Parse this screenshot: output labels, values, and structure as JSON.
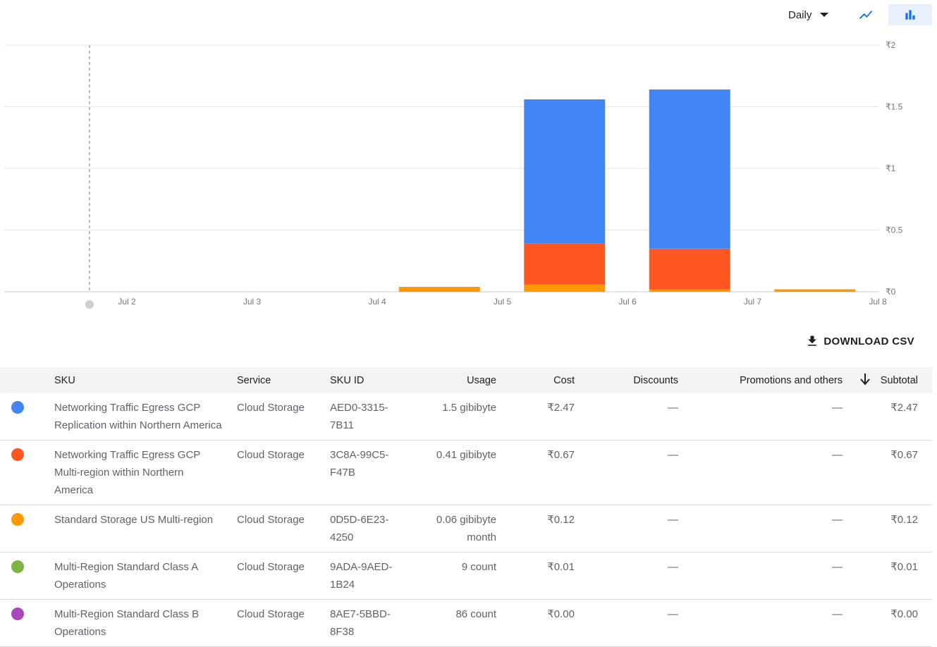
{
  "toolbar": {
    "granularity": "Daily",
    "view_line_icon": "show-chart-icon",
    "view_bar_icon": "bar-chart-icon"
  },
  "chart_data": {
    "type": "bar",
    "stacked": true,
    "categories": [
      "Jul 2",
      "Jul 3",
      "Jul 4",
      "Jul 5",
      "Jul 6",
      "Jul 7"
    ],
    "x_tick_labels": [
      "Jul 2",
      "Jul 3",
      "Jul 4",
      "Jul 5",
      "Jul 6",
      "Jul 7",
      "Jul 8"
    ],
    "y_tick_labels": [
      "₹0",
      "₹0.5",
      "₹1",
      "₹1.5",
      "₹2"
    ],
    "y_ticks": [
      0,
      0.5,
      1,
      1.5,
      2
    ],
    "ylim": [
      0,
      2
    ],
    "grid": true,
    "y_axis_side": "right",
    "series": [
      {
        "color": "#ff9800",
        "values": [
          0,
          0,
          0.04,
          0.06,
          0.02,
          0.02
        ]
      },
      {
        "color": "#ff5722",
        "values": [
          0,
          0,
          0,
          0.33,
          0.33,
          0
        ]
      },
      {
        "color": "#4285f4",
        "values": [
          0,
          0,
          0,
          1.17,
          1.29,
          0
        ]
      }
    ]
  },
  "download_label": "DOWNLOAD CSV",
  "download_icon": "download-icon",
  "table": {
    "headers": {
      "sku": "SKU",
      "service": "Service",
      "sku_id": "SKU ID",
      "usage": "Usage",
      "cost": "Cost",
      "discounts": "Discounts",
      "promotions": "Promotions and others",
      "subtotal": "Subtotal"
    },
    "sort_icon": "arrow-downward-icon",
    "rows": [
      {
        "color": "#4285f4",
        "sku": "Networking Traffic Egress GCP Replication within Northern America",
        "service": "Cloud Storage",
        "sku_id": "AED0-3315-7B11",
        "usage": "1.5 gibibyte",
        "cost": "₹2.47",
        "discounts": "—",
        "promotions": "—",
        "subtotal": "₹2.47"
      },
      {
        "color": "#ff5722",
        "sku": "Networking Traffic Egress GCP Multi-region within Northern America",
        "service": "Cloud Storage",
        "sku_id": "3C8A-99C5-F47B",
        "usage": "0.41 gibibyte",
        "cost": "₹0.67",
        "discounts": "—",
        "promotions": "—",
        "subtotal": "₹0.67"
      },
      {
        "color": "#ff9800",
        "sku": "Standard Storage US Multi-region",
        "service": "Cloud Storage",
        "sku_id": "0D5D-6E23-4250",
        "usage": "0.06 gibibyte month",
        "cost": "₹0.12",
        "discounts": "—",
        "promotions": "—",
        "subtotal": "₹0.12"
      },
      {
        "color": "#7cb342",
        "sku": "Multi-Region Standard Class A Operations",
        "service": "Cloud Storage",
        "sku_id": "9ADA-9AED-1B24",
        "usage": "9 count",
        "cost": "₹0.01",
        "discounts": "—",
        "promotions": "—",
        "subtotal": "₹0.01"
      },
      {
        "color": "#ab47bc",
        "sku": "Multi-Region Standard Class B Operations",
        "service": "Cloud Storage",
        "sku_id": "8AE7-5BBD-8F38",
        "usage": "86 count",
        "cost": "₹0.00",
        "discounts": "—",
        "promotions": "—",
        "subtotal": "₹0.00"
      }
    ]
  }
}
